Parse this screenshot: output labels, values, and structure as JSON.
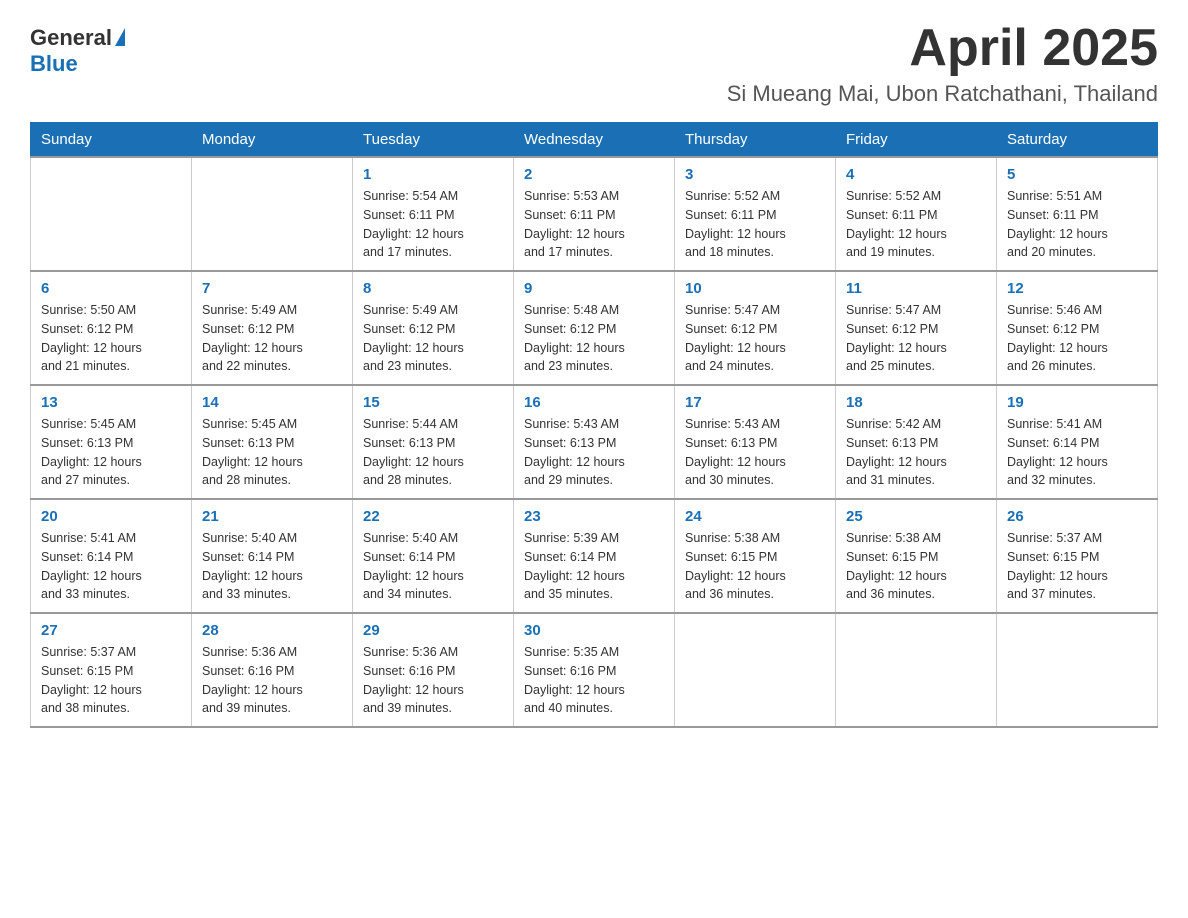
{
  "logo": {
    "text_general": "General",
    "text_blue": "Blue",
    "triangle_label": "logo-triangle"
  },
  "header": {
    "month_year": "April 2025",
    "location": "Si Mueang Mai, Ubon Ratchathani, Thailand"
  },
  "weekdays": [
    "Sunday",
    "Monday",
    "Tuesday",
    "Wednesday",
    "Thursday",
    "Friday",
    "Saturday"
  ],
  "weeks": [
    [
      {
        "day": "",
        "info": ""
      },
      {
        "day": "",
        "info": ""
      },
      {
        "day": "1",
        "info": "Sunrise: 5:54 AM\nSunset: 6:11 PM\nDaylight: 12 hours\nand 17 minutes."
      },
      {
        "day": "2",
        "info": "Sunrise: 5:53 AM\nSunset: 6:11 PM\nDaylight: 12 hours\nand 17 minutes."
      },
      {
        "day": "3",
        "info": "Sunrise: 5:52 AM\nSunset: 6:11 PM\nDaylight: 12 hours\nand 18 minutes."
      },
      {
        "day": "4",
        "info": "Sunrise: 5:52 AM\nSunset: 6:11 PM\nDaylight: 12 hours\nand 19 minutes."
      },
      {
        "day": "5",
        "info": "Sunrise: 5:51 AM\nSunset: 6:11 PM\nDaylight: 12 hours\nand 20 minutes."
      }
    ],
    [
      {
        "day": "6",
        "info": "Sunrise: 5:50 AM\nSunset: 6:12 PM\nDaylight: 12 hours\nand 21 minutes."
      },
      {
        "day": "7",
        "info": "Sunrise: 5:49 AM\nSunset: 6:12 PM\nDaylight: 12 hours\nand 22 minutes."
      },
      {
        "day": "8",
        "info": "Sunrise: 5:49 AM\nSunset: 6:12 PM\nDaylight: 12 hours\nand 23 minutes."
      },
      {
        "day": "9",
        "info": "Sunrise: 5:48 AM\nSunset: 6:12 PM\nDaylight: 12 hours\nand 23 minutes."
      },
      {
        "day": "10",
        "info": "Sunrise: 5:47 AM\nSunset: 6:12 PM\nDaylight: 12 hours\nand 24 minutes."
      },
      {
        "day": "11",
        "info": "Sunrise: 5:47 AM\nSunset: 6:12 PM\nDaylight: 12 hours\nand 25 minutes."
      },
      {
        "day": "12",
        "info": "Sunrise: 5:46 AM\nSunset: 6:12 PM\nDaylight: 12 hours\nand 26 minutes."
      }
    ],
    [
      {
        "day": "13",
        "info": "Sunrise: 5:45 AM\nSunset: 6:13 PM\nDaylight: 12 hours\nand 27 minutes."
      },
      {
        "day": "14",
        "info": "Sunrise: 5:45 AM\nSunset: 6:13 PM\nDaylight: 12 hours\nand 28 minutes."
      },
      {
        "day": "15",
        "info": "Sunrise: 5:44 AM\nSunset: 6:13 PM\nDaylight: 12 hours\nand 28 minutes."
      },
      {
        "day": "16",
        "info": "Sunrise: 5:43 AM\nSunset: 6:13 PM\nDaylight: 12 hours\nand 29 minutes."
      },
      {
        "day": "17",
        "info": "Sunrise: 5:43 AM\nSunset: 6:13 PM\nDaylight: 12 hours\nand 30 minutes."
      },
      {
        "day": "18",
        "info": "Sunrise: 5:42 AM\nSunset: 6:13 PM\nDaylight: 12 hours\nand 31 minutes."
      },
      {
        "day": "19",
        "info": "Sunrise: 5:41 AM\nSunset: 6:14 PM\nDaylight: 12 hours\nand 32 minutes."
      }
    ],
    [
      {
        "day": "20",
        "info": "Sunrise: 5:41 AM\nSunset: 6:14 PM\nDaylight: 12 hours\nand 33 minutes."
      },
      {
        "day": "21",
        "info": "Sunrise: 5:40 AM\nSunset: 6:14 PM\nDaylight: 12 hours\nand 33 minutes."
      },
      {
        "day": "22",
        "info": "Sunrise: 5:40 AM\nSunset: 6:14 PM\nDaylight: 12 hours\nand 34 minutes."
      },
      {
        "day": "23",
        "info": "Sunrise: 5:39 AM\nSunset: 6:14 PM\nDaylight: 12 hours\nand 35 minutes."
      },
      {
        "day": "24",
        "info": "Sunrise: 5:38 AM\nSunset: 6:15 PM\nDaylight: 12 hours\nand 36 minutes."
      },
      {
        "day": "25",
        "info": "Sunrise: 5:38 AM\nSunset: 6:15 PM\nDaylight: 12 hours\nand 36 minutes."
      },
      {
        "day": "26",
        "info": "Sunrise: 5:37 AM\nSunset: 6:15 PM\nDaylight: 12 hours\nand 37 minutes."
      }
    ],
    [
      {
        "day": "27",
        "info": "Sunrise: 5:37 AM\nSunset: 6:15 PM\nDaylight: 12 hours\nand 38 minutes."
      },
      {
        "day": "28",
        "info": "Sunrise: 5:36 AM\nSunset: 6:16 PM\nDaylight: 12 hours\nand 39 minutes."
      },
      {
        "day": "29",
        "info": "Sunrise: 5:36 AM\nSunset: 6:16 PM\nDaylight: 12 hours\nand 39 minutes."
      },
      {
        "day": "30",
        "info": "Sunrise: 5:35 AM\nSunset: 6:16 PM\nDaylight: 12 hours\nand 40 minutes."
      },
      {
        "day": "",
        "info": ""
      },
      {
        "day": "",
        "info": ""
      },
      {
        "day": "",
        "info": ""
      }
    ]
  ]
}
